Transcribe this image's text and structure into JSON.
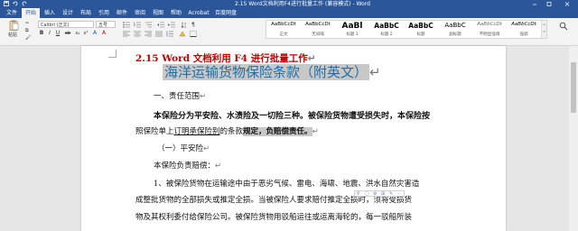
{
  "window": {
    "title": "2.15 Word文档利用F4进行批量工作 (兼容模式) - Word"
  },
  "ribbon_tabs": [
    "文件",
    "开始",
    "插入",
    "设计",
    "布局",
    "引用",
    "邮件",
    "审阅",
    "视图",
    "帮助",
    "Acrobat",
    "百度网盘"
  ],
  "ribbon": {
    "paste_label": "粘贴",
    "font_name": "Calibri (正文)",
    "font_size": "五号",
    "format_buttons": [
      "B",
      "I",
      "U",
      "ab",
      "x₂",
      "x²"
    ],
    "styles": [
      {
        "sample": "AaBbCcDt",
        "label": "正文"
      },
      {
        "sample": "AaBbCcDt",
        "label": "无间隔"
      },
      {
        "sample": "AaBl",
        "label": "标题 1"
      },
      {
        "sample": "AaBbC",
        "label": "标题 2"
      },
      {
        "sample": "AaBbC",
        "label": "标题"
      },
      {
        "sample": "AaBbC",
        "label": "副标题"
      },
      {
        "sample": "AaBbCcDt",
        "label": "不明显强调"
      },
      {
        "sample": "AaBbCcDt",
        "label": "强调"
      }
    ]
  },
  "document": {
    "heading_prefix": "2.15 Word 文档利用 F4 进行批量工作",
    "title": "海洋运输货物保险条款（附英文）",
    "section1": "一、责任范围",
    "para1a": "本保险分为平安险、水渍险及一切险三种。被保险货物遭受损失时，本保险按",
    "para1b_pre": "照保险单上",
    "para1b_link": "订明承保险别",
    "para1b_mid": "的条款",
    "para1b_sel": "规定，负赔偿责任。",
    "sub1": "（一）平安险",
    "sub1_desc": "本保险负责赔偿：",
    "item1a": "1、被保险货物在运输途中由于恶劣气候、雷电、海啸、地震、洪水自然灾害造",
    "item1b": "成整批货物的全部损失或推定全损。当被保险人要求赔付推定全损时，须将受损货",
    "item1c": "物及其权利委付给保险公司。被保险货物用驳船运往或运离海轮的，每一驳船所装"
  },
  "colors": {
    "accent": "#2b579a",
    "heading_red": "#c00000",
    "title_blue": "#1f6fa8",
    "selection": "#c8c8c8"
  }
}
